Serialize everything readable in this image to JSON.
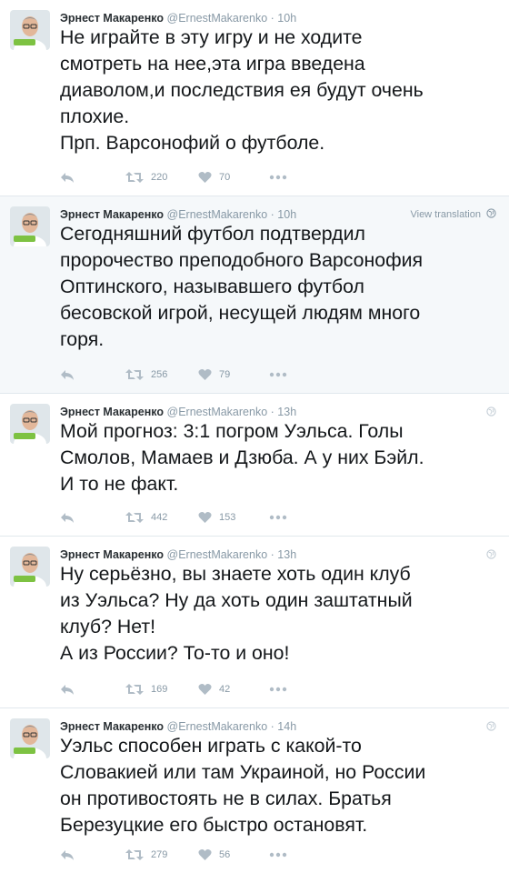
{
  "colors": {
    "name": "#292f33",
    "meta": "#8899a6",
    "text": "#14171a",
    "highlight_bg": "#f5f8fa",
    "divider": "#e1e8ed"
  },
  "tweets": [
    {
      "name": "Эрнест Макаренко",
      "handle": "@ErnestMakarenko",
      "dot": "·",
      "time": "10h",
      "text": "Не играйте в эту игру и не ходите\nсмотреть на нее,эта игра введена\nдиаволом,и последствия ея будут очень\nплохие.\nПрп. Варсонофий о футболе.",
      "retweets": "220",
      "likes": "70"
    },
    {
      "name": "Эрнест Макаренко",
      "handle": "@ErnestMakarenko",
      "dot": "·",
      "time": "10h",
      "translation": "View translation",
      "text": "Сегодняшний футбол подтвердил\nпророчество преподобного Варсонофия\nОптинского, называвшего футбол\nбесовской игрой, несущей людям много\nгоря.",
      "retweets": "256",
      "likes": "79"
    },
    {
      "name": "Эрнест Макаренко",
      "handle": "@ErnestMakarenko",
      "dot": "·",
      "time": "13h",
      "text": "Мой прогноз: 3:1 погром Уэльса. Голы\nСмолов, Мамаев и Дзюба. А у них Бэйл.\nИ то не факт.",
      "retweets": "442",
      "likes": "153"
    },
    {
      "name": "Эрнест Макаренко",
      "handle": "@ErnestMakarenko",
      "dot": "·",
      "time": "13h",
      "text": "Ну серьёзно, вы знаете хоть один клуб\nиз Уэльса? Ну да хоть один заштатный\nклуб? Нет!\nА из России? То-то и оно!",
      "retweets": "169",
      "likes": "42"
    },
    {
      "name": "Эрнест Макаренко",
      "handle": "@ErnestMakarenko",
      "dot": "·",
      "time": "14h",
      "text": "Уэльс способен играть с какой-то\nСловакией или там Украиной, но России\nон противостоять не в силах. Братья\nБерезуцкие его быстро остановят.",
      "retweets": "279",
      "likes": "56"
    }
  ]
}
